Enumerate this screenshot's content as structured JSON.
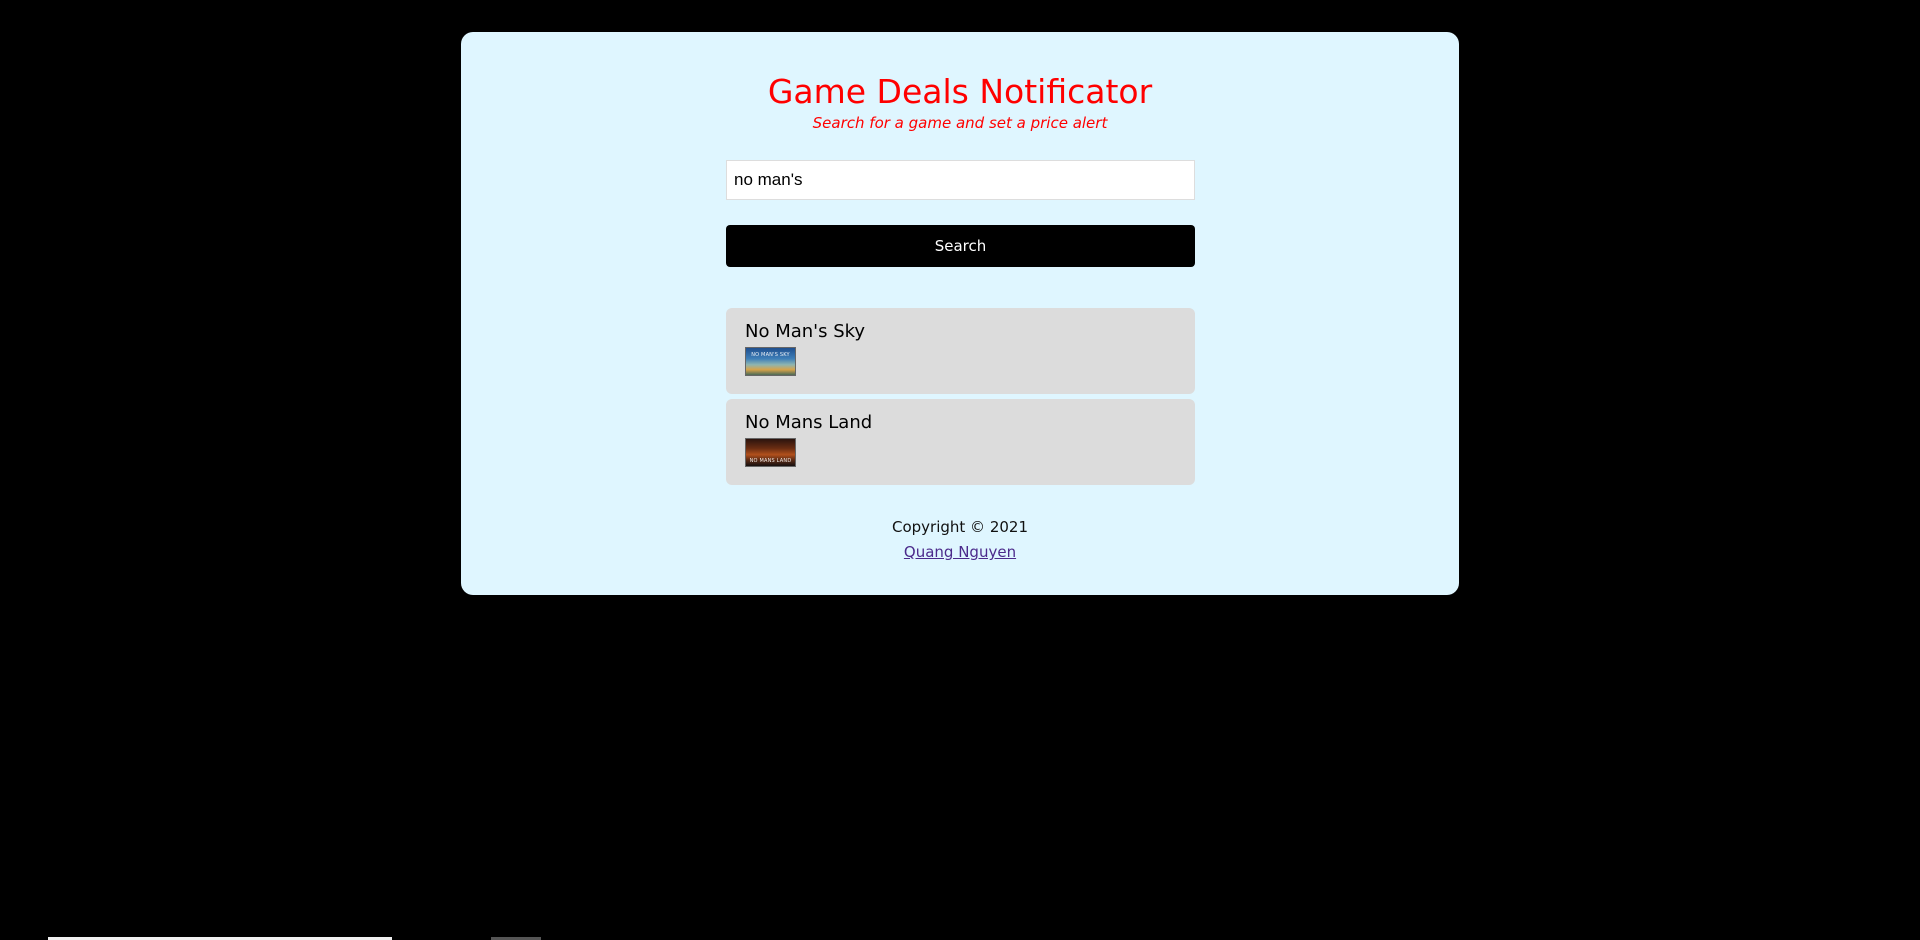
{
  "header": {
    "title": "Game Deals Notificator",
    "subtitle": "Search for a game and set a price alert"
  },
  "search": {
    "value": "no man's",
    "button_label": "Search"
  },
  "results": [
    {
      "title": "No Man's Sky",
      "thumbnail_text": "NO MAN'S SKY"
    },
    {
      "title": "No Mans Land",
      "thumbnail_text": "NO MANS LAND"
    }
  ],
  "footer": {
    "copyright": "Copyright © 2021",
    "author_link": "Quang Nguyen"
  },
  "colors": {
    "background": "#000000",
    "card": "#dff6ff",
    "title": "#ff0000",
    "button": "#000000",
    "result_card": "#dcdcdc",
    "link": "#4b2a8b"
  }
}
